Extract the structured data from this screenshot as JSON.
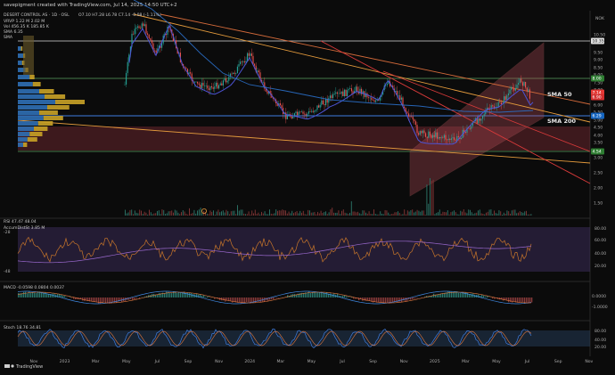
{
  "header": {
    "publisher": "savepigment created with TradingView.com, Jul 14, 2025 14:50 UTC+2"
  },
  "symbol": {
    "title": "DESERT CONTROL AS · 1D · OSL",
    "ohlc": "O7.10 H7.28 L6.78 C7.14 -0.08 (-1.11%)",
    "vrvp": "VRVP  1.22 M  2.02 M",
    "vol": "Vol  456.35 K  185.85 K",
    "sma50": "SMA  6.35",
    "sma200": "SMA"
  },
  "currency": "NOK",
  "annotations": {
    "sma50": "SMA 50",
    "sma200": "SMA 200"
  },
  "price_axis": {
    "ticks": [
      "10.50",
      "9.50",
      "9.00",
      "8.50",
      "8.00",
      "7.50",
      "7.00",
      "6.50",
      "6.00",
      "5.50",
      "5.00",
      "4.50",
      "4.00",
      "3.50",
      "3.00",
      "2.50",
      "2.00",
      "1.50",
      "1.00",
      "0.500"
    ],
    "badges": [
      {
        "label": "10.35",
        "color": "#dddddd",
        "text_color": "#111111"
      },
      {
        "label": "8.00",
        "color": "#2e7d32",
        "text_color": "#ffffff"
      },
      {
        "label": "7.14",
        "color": "#e53935",
        "text_color": "#ffffff"
      },
      {
        "label": "6.90",
        "color": "#d32f2f",
        "text_color": "#ffffff"
      },
      {
        "label": "6.29",
        "color": "#1565c0",
        "text_color": "#ffffff"
      },
      {
        "label": "4.54",
        "color": "#2e7d32",
        "text_color": "#ffffff"
      }
    ]
  },
  "time_axis": [
    "Nov",
    "2023",
    "Mar",
    "May",
    "Jul",
    "Sep",
    "Nov",
    "2024",
    "Mar",
    "May",
    "Jul",
    "Sep",
    "Nov",
    "2025",
    "Mar",
    "May",
    "Jul",
    "Sep",
    "Nov"
  ],
  "rsi": {
    "label": "RSI  47.47  48.04",
    "sub": "AccumDistSt  3.85 M",
    "ticks": [
      "80.00",
      "60.00",
      "40.00",
      "20.00"
    ],
    "left_ticks": [
      "-28",
      "-48"
    ]
  },
  "macd": {
    "label": "MACD  -0.0598  0.0804  0.0037",
    "ticks": [
      "0.0000",
      "-1.0000"
    ]
  },
  "stoch": {
    "label": "Stoch  18.76  34.81",
    "ticks": [
      "80.00",
      "40.00",
      "20.00"
    ]
  },
  "branding": "TradingView",
  "colors": {
    "background": "#0b0b0b",
    "up": "#26a69a",
    "down": "#ef5350",
    "profile_up": "#2f6fb5",
    "profile_down": "#c9a227",
    "sma50": "#4d54d6",
    "trend_orange": "#e39a3c",
    "trend_red": "#d83a3a"
  }
}
